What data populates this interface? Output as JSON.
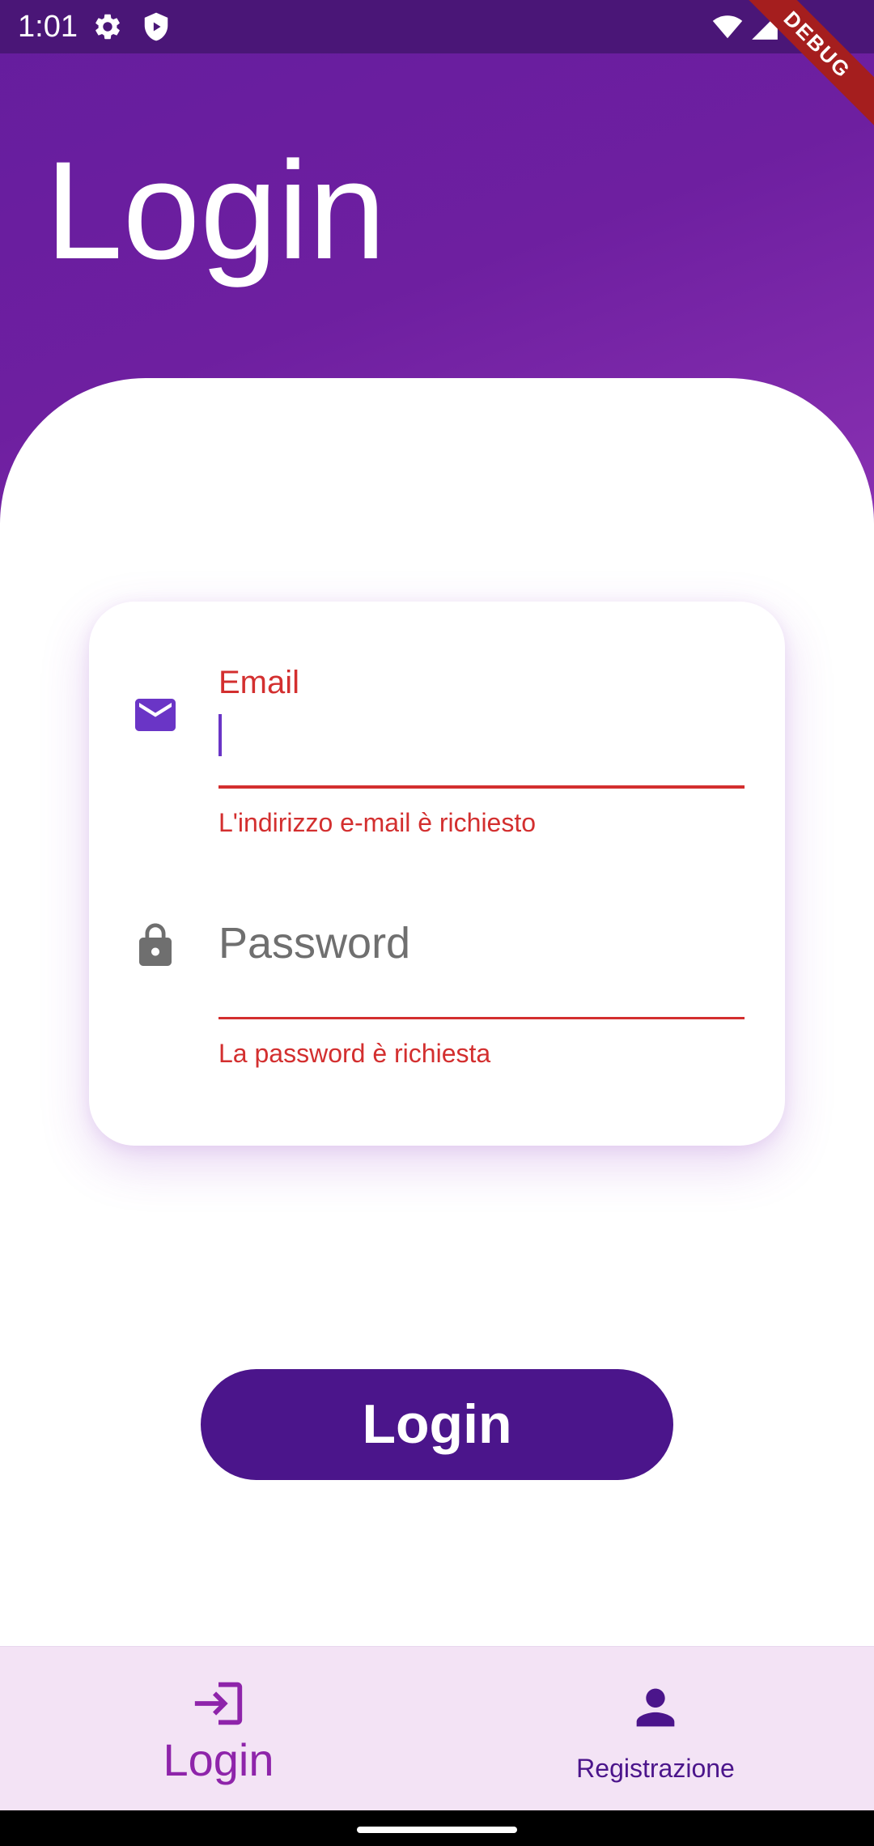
{
  "status_bar": {
    "time": "1:01",
    "left_icons": [
      "settings-icon",
      "shield-icon"
    ],
    "right_icons": [
      "wifi-icon",
      "signal-icon",
      "battery-icon"
    ]
  },
  "debug_banner": "DEBUG",
  "header": {
    "title": "Login"
  },
  "form": {
    "email": {
      "icon": "mail-icon",
      "label": "Email",
      "value": "",
      "error": "L'indirizzo e-mail è richiesto"
    },
    "password": {
      "icon": "lock-icon",
      "placeholder": "Password",
      "value": "",
      "error": "La password è richiesta"
    }
  },
  "login_button": {
    "label": "Login"
  },
  "bottom_nav": {
    "items": [
      {
        "icon": "login-icon",
        "label": "Login",
        "selected": true
      },
      {
        "icon": "person-icon",
        "label": "Registrazione",
        "selected": false
      }
    ]
  },
  "colors": {
    "primary": "#4b158b",
    "header_gradient_start": "#651d9e",
    "header_gradient_end": "#8b32b3",
    "error": "#d32f2f",
    "nav_background": "#f3e3f5",
    "nav_selected": "#8e24aa",
    "email_icon": "#6a35c6",
    "lock_icon": "#6f6f6f"
  }
}
